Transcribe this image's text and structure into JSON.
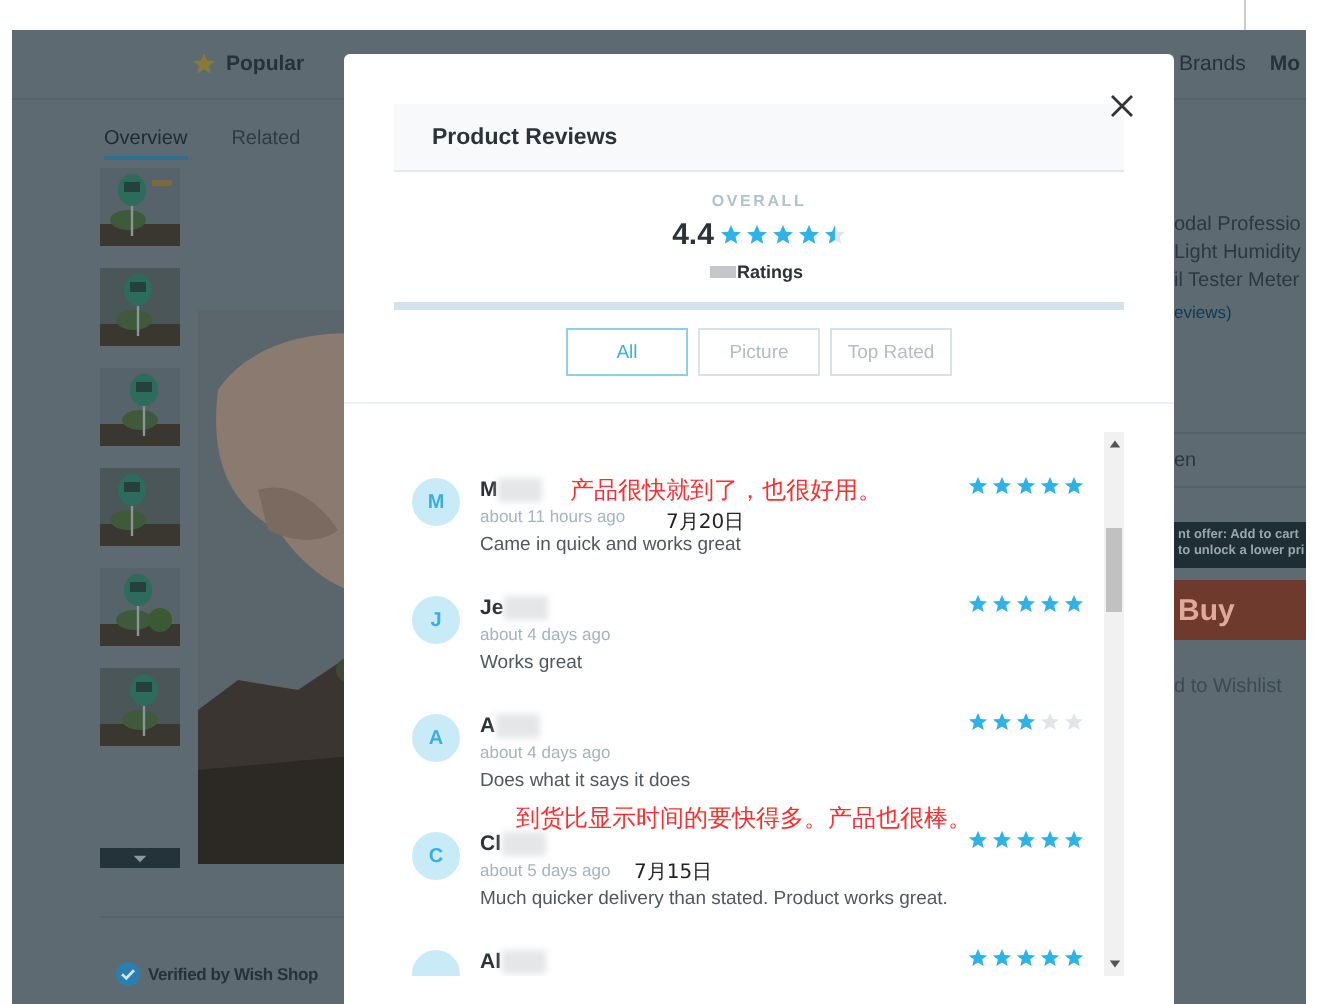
{
  "page": {
    "nav": {
      "popular": "Popular",
      "brands": "Brands",
      "more": "Mo"
    },
    "tabs": [
      {
        "label": "Overview",
        "selected": true
      },
      {
        "label": "Related",
        "selected": false
      }
    ],
    "verified": "Verified by Wish Shop",
    "side": {
      "title_lines": [
        "odal Professio",
        "Light Humidity",
        "il Tester Meter"
      ],
      "reviews_link": "eviews)",
      "option": "en",
      "offer_lines": [
        "nt offer: Add to cart",
        "to unlock a lower pri"
      ],
      "buy": "Buy",
      "wishlist": "d to Wishlist"
    }
  },
  "modal": {
    "title": "Product Reviews",
    "overall_label": "OVERALL",
    "score": "4.4",
    "stars": 4.5,
    "ratings_label": "Ratings",
    "filters": [
      {
        "label": "All",
        "selected": true
      },
      {
        "label": "Picture",
        "selected": false
      },
      {
        "label": "Top Rated",
        "selected": false
      }
    ],
    "reviews": [
      {
        "initial": "M",
        "name": "M",
        "time": "about 11 hours ago",
        "text": "Came in quick and works great",
        "stars": 5
      },
      {
        "initial": "J",
        "name": "Je",
        "time": "about 4 days ago",
        "text": "Works great",
        "stars": 5
      },
      {
        "initial": "A",
        "name": "A",
        "time": "about 4 days ago",
        "text": "Does what it says it does",
        "stars": 3
      },
      {
        "initial": "C",
        "name": "Cl",
        "time": "about 5 days ago",
        "text": "Much quicker delivery than stated. Product works great.",
        "stars": 5
      },
      {
        "name": "Al",
        "stars": 5
      }
    ],
    "annotations": [
      {
        "kind": "translation",
        "text": "产品很快就到了，也很好用。"
      },
      {
        "kind": "date",
        "text": "7月20日"
      },
      {
        "kind": "translation",
        "text": "到货比显示时间的要快得多。产品也很棒。"
      },
      {
        "kind": "date",
        "text": "7月15日"
      }
    ]
  }
}
